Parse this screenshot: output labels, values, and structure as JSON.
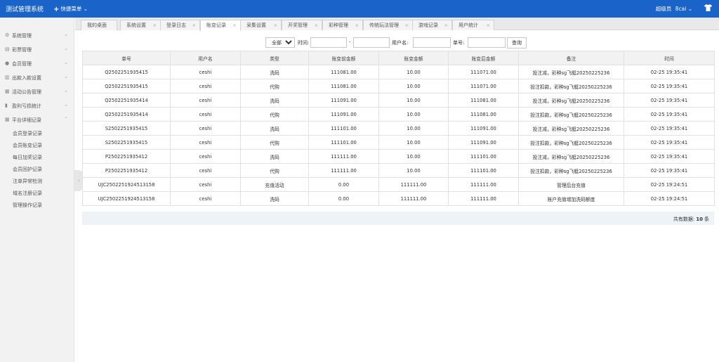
{
  "header": {
    "title": "测试管理系统",
    "quick_menu": "快捷菜单",
    "user_role": "超级员",
    "user_name": "8cai"
  },
  "sidebar": {
    "items": [
      {
        "label": "系统管理",
        "icon": "gear-icon"
      },
      {
        "label": "彩票管理",
        "icon": "ticket-icon"
      },
      {
        "label": "会员管理",
        "icon": "user-icon"
      },
      {
        "label": "出款入款设置",
        "icon": "money-icon"
      },
      {
        "label": "活动公告管理",
        "icon": "grid-icon"
      },
      {
        "label": "盈利亏损统计",
        "icon": "chart-icon"
      },
      {
        "label": "平台详细记录",
        "icon": "grid-icon"
      }
    ],
    "sub_items": [
      "会员登录记录",
      "会员账变记录",
      "每日加奖记录",
      "会员回护记录",
      "注单异常检测",
      "域名注册记录",
      "管理操作记录"
    ]
  },
  "tabs": [
    {
      "label": "我的桌面"
    },
    {
      "label": "系统设置"
    },
    {
      "label": "登录日志"
    },
    {
      "label": "账变记录"
    },
    {
      "label": "采集设置"
    },
    {
      "label": "开奖管理"
    },
    {
      "label": "彩种管理"
    },
    {
      "label": "传统玩法管理"
    },
    {
      "label": "游戏记录"
    },
    {
      "label": "用户统计"
    }
  ],
  "filter": {
    "type_selected": "全部",
    "time_label": "时间:",
    "dash": "-",
    "username_label": "用户名:",
    "order_label": "单号:",
    "search_button": "查询"
  },
  "table": {
    "columns": [
      "单号",
      "用户名",
      "类型",
      "账变前金额",
      "账变金额",
      "账变后金额",
      "备注",
      "时间"
    ],
    "rows": [
      [
        "Q2502251935415",
        "ceshi",
        "洗码",
        "111081.00",
        "10.00",
        "111071.00",
        "投注减，彩种sg飞艇20250225236",
        "02-25 19:35:41"
      ],
      [
        "Q2502251935415",
        "ceshi",
        "代购",
        "111081.00",
        "10.00",
        "111071.00",
        "投注扣款，彩种sg飞艇20250225236",
        "02-25 19:35:41"
      ],
      [
        "Q2502251935414",
        "ceshi",
        "洗码",
        "111091.00",
        "10.00",
        "111081.00",
        "投注减，彩种sg飞艇20250225236",
        "02-25 19:35:41"
      ],
      [
        "Q2502251935414",
        "ceshi",
        "代购",
        "111091.00",
        "10.00",
        "111081.00",
        "投注扣款，彩种sg飞艇20250225236",
        "02-25 19:35:41"
      ],
      [
        "S2502251935415",
        "ceshi",
        "洗码",
        "111101.00",
        "10.00",
        "111091.00",
        "投注减，彩种sg飞艇20250225236",
        "02-25 19:35:41"
      ],
      [
        "S2502251935415",
        "ceshi",
        "代购",
        "111101.00",
        "10.00",
        "111091.00",
        "投注扣款，彩种sg飞艇20250225236",
        "02-25 19:35:41"
      ],
      [
        "P2502251935412",
        "ceshi",
        "洗码",
        "111111.00",
        "10.00",
        "111101.00",
        "投注减，彩种sg飞艇20250225236",
        "02-25 19:35:41"
      ],
      [
        "P2502251935412",
        "ceshi",
        "代购",
        "111111.00",
        "10.00",
        "111101.00",
        "投注扣款，彩种sg飞艇20250225236",
        "02-25 19:35:41"
      ],
      [
        "UJC2502251924513158",
        "ceshi",
        "充值活动",
        "0.00",
        "111111.00",
        "111111.00",
        "管理后台充值",
        "02-25 19:24:51"
      ],
      [
        "UJC2502251924513158",
        "ceshi",
        "洗码",
        "0.00",
        "111111.00",
        "111111.00",
        "账户充值增加洗码额度",
        "02-25 19:24:51"
      ]
    ]
  },
  "footer": {
    "total_label": "共有数据:",
    "total_count": "10",
    "total_unit": "条"
  },
  "colors": {
    "header_bg": "#1a63c9",
    "sidebar_bg": "#f2f2f2",
    "footer_bg": "#eef3f8"
  }
}
